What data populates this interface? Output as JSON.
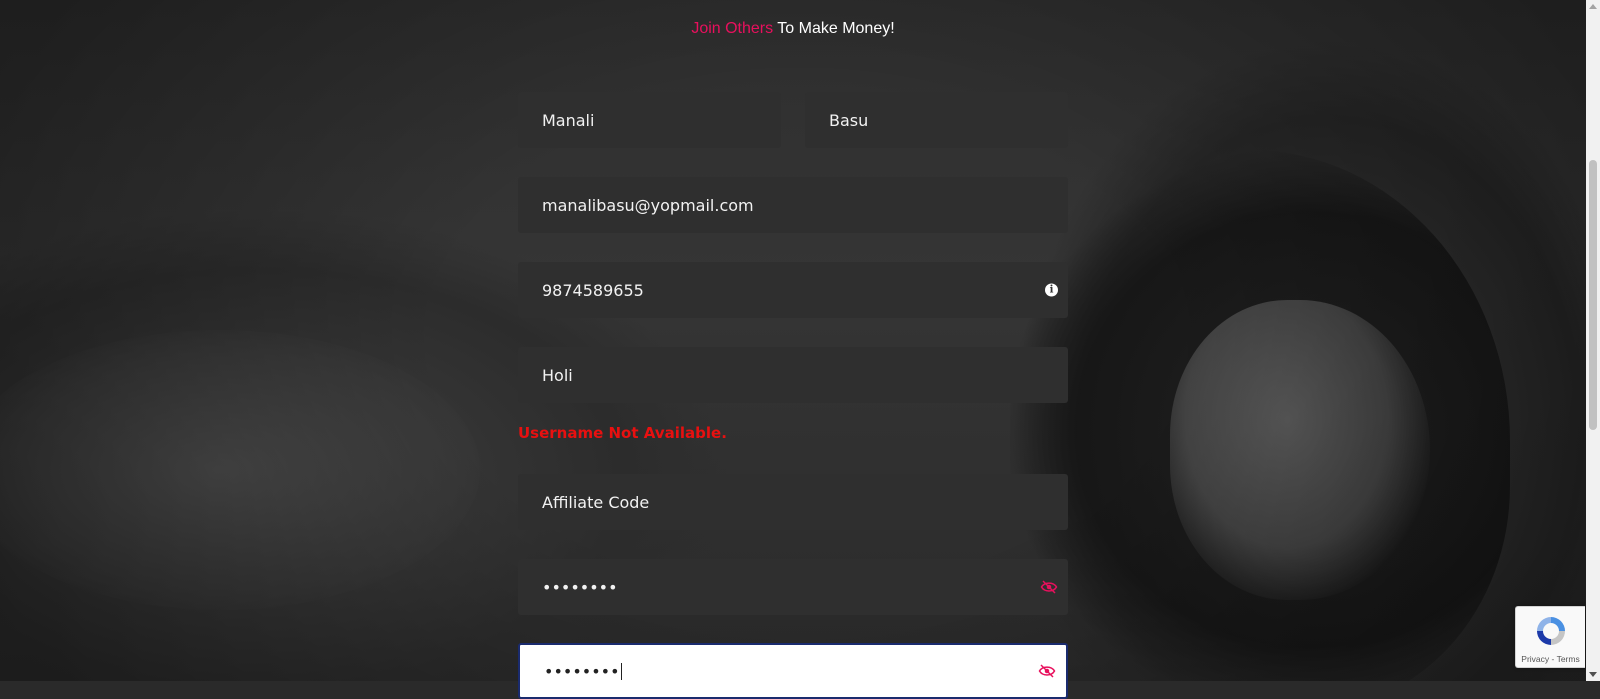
{
  "headline": {
    "accent": "Join Others",
    "rest": " To Make Money!"
  },
  "colors": {
    "accent": "#e8105d",
    "error": "#e81010",
    "field_bg": "#2f2f2f",
    "focus_border": "#1a2b6e"
  },
  "form": {
    "first_name": {
      "value": "Manali"
    },
    "last_name": {
      "value": "Basu"
    },
    "email": {
      "value": "manalibasu@yopmail.com"
    },
    "phone": {
      "value": "9874589655",
      "icon": "info-icon"
    },
    "username": {
      "value": "Holi"
    },
    "username_error": "Username Not Available.",
    "affiliate_code": {
      "placeholder": "Affiliate Code",
      "value": ""
    },
    "password": {
      "value": "••••••••",
      "icon": "eye-slash-icon"
    },
    "confirm_password": {
      "value": "••••••••",
      "icon": "eye-slash-icon"
    }
  },
  "recaptcha": {
    "links": "Privacy - Terms",
    "icon": "recaptcha-logo-icon"
  }
}
